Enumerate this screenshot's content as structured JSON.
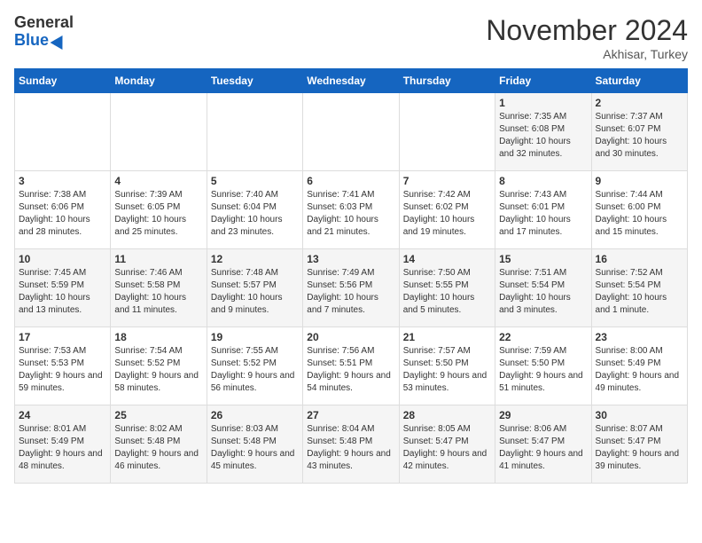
{
  "header": {
    "logo_general": "General",
    "logo_blue": "Blue",
    "month_title": "November 2024",
    "location": "Akhisar, Turkey"
  },
  "weekdays": [
    "Sunday",
    "Monday",
    "Tuesday",
    "Wednesday",
    "Thursday",
    "Friday",
    "Saturday"
  ],
  "weeks": [
    [
      {
        "day": "",
        "info": ""
      },
      {
        "day": "",
        "info": ""
      },
      {
        "day": "",
        "info": ""
      },
      {
        "day": "",
        "info": ""
      },
      {
        "day": "",
        "info": ""
      },
      {
        "day": "1",
        "info": "Sunrise: 7:35 AM\nSunset: 6:08 PM\nDaylight: 10 hours and 32 minutes."
      },
      {
        "day": "2",
        "info": "Sunrise: 7:37 AM\nSunset: 6:07 PM\nDaylight: 10 hours and 30 minutes."
      }
    ],
    [
      {
        "day": "3",
        "info": "Sunrise: 7:38 AM\nSunset: 6:06 PM\nDaylight: 10 hours and 28 minutes."
      },
      {
        "day": "4",
        "info": "Sunrise: 7:39 AM\nSunset: 6:05 PM\nDaylight: 10 hours and 25 minutes."
      },
      {
        "day": "5",
        "info": "Sunrise: 7:40 AM\nSunset: 6:04 PM\nDaylight: 10 hours and 23 minutes."
      },
      {
        "day": "6",
        "info": "Sunrise: 7:41 AM\nSunset: 6:03 PM\nDaylight: 10 hours and 21 minutes."
      },
      {
        "day": "7",
        "info": "Sunrise: 7:42 AM\nSunset: 6:02 PM\nDaylight: 10 hours and 19 minutes."
      },
      {
        "day": "8",
        "info": "Sunrise: 7:43 AM\nSunset: 6:01 PM\nDaylight: 10 hours and 17 minutes."
      },
      {
        "day": "9",
        "info": "Sunrise: 7:44 AM\nSunset: 6:00 PM\nDaylight: 10 hours and 15 minutes."
      }
    ],
    [
      {
        "day": "10",
        "info": "Sunrise: 7:45 AM\nSunset: 5:59 PM\nDaylight: 10 hours and 13 minutes."
      },
      {
        "day": "11",
        "info": "Sunrise: 7:46 AM\nSunset: 5:58 PM\nDaylight: 10 hours and 11 minutes."
      },
      {
        "day": "12",
        "info": "Sunrise: 7:48 AM\nSunset: 5:57 PM\nDaylight: 10 hours and 9 minutes."
      },
      {
        "day": "13",
        "info": "Sunrise: 7:49 AM\nSunset: 5:56 PM\nDaylight: 10 hours and 7 minutes."
      },
      {
        "day": "14",
        "info": "Sunrise: 7:50 AM\nSunset: 5:55 PM\nDaylight: 10 hours and 5 minutes."
      },
      {
        "day": "15",
        "info": "Sunrise: 7:51 AM\nSunset: 5:54 PM\nDaylight: 10 hours and 3 minutes."
      },
      {
        "day": "16",
        "info": "Sunrise: 7:52 AM\nSunset: 5:54 PM\nDaylight: 10 hours and 1 minute."
      }
    ],
    [
      {
        "day": "17",
        "info": "Sunrise: 7:53 AM\nSunset: 5:53 PM\nDaylight: 9 hours and 59 minutes."
      },
      {
        "day": "18",
        "info": "Sunrise: 7:54 AM\nSunset: 5:52 PM\nDaylight: 9 hours and 58 minutes."
      },
      {
        "day": "19",
        "info": "Sunrise: 7:55 AM\nSunset: 5:52 PM\nDaylight: 9 hours and 56 minutes."
      },
      {
        "day": "20",
        "info": "Sunrise: 7:56 AM\nSunset: 5:51 PM\nDaylight: 9 hours and 54 minutes."
      },
      {
        "day": "21",
        "info": "Sunrise: 7:57 AM\nSunset: 5:50 PM\nDaylight: 9 hours and 53 minutes."
      },
      {
        "day": "22",
        "info": "Sunrise: 7:59 AM\nSunset: 5:50 PM\nDaylight: 9 hours and 51 minutes."
      },
      {
        "day": "23",
        "info": "Sunrise: 8:00 AM\nSunset: 5:49 PM\nDaylight: 9 hours and 49 minutes."
      }
    ],
    [
      {
        "day": "24",
        "info": "Sunrise: 8:01 AM\nSunset: 5:49 PM\nDaylight: 9 hours and 48 minutes."
      },
      {
        "day": "25",
        "info": "Sunrise: 8:02 AM\nSunset: 5:48 PM\nDaylight: 9 hours and 46 minutes."
      },
      {
        "day": "26",
        "info": "Sunrise: 8:03 AM\nSunset: 5:48 PM\nDaylight: 9 hours and 45 minutes."
      },
      {
        "day": "27",
        "info": "Sunrise: 8:04 AM\nSunset: 5:48 PM\nDaylight: 9 hours and 43 minutes."
      },
      {
        "day": "28",
        "info": "Sunrise: 8:05 AM\nSunset: 5:47 PM\nDaylight: 9 hours and 42 minutes."
      },
      {
        "day": "29",
        "info": "Sunrise: 8:06 AM\nSunset: 5:47 PM\nDaylight: 9 hours and 41 minutes."
      },
      {
        "day": "30",
        "info": "Sunrise: 8:07 AM\nSunset: 5:47 PM\nDaylight: 9 hours and 39 minutes."
      }
    ]
  ]
}
